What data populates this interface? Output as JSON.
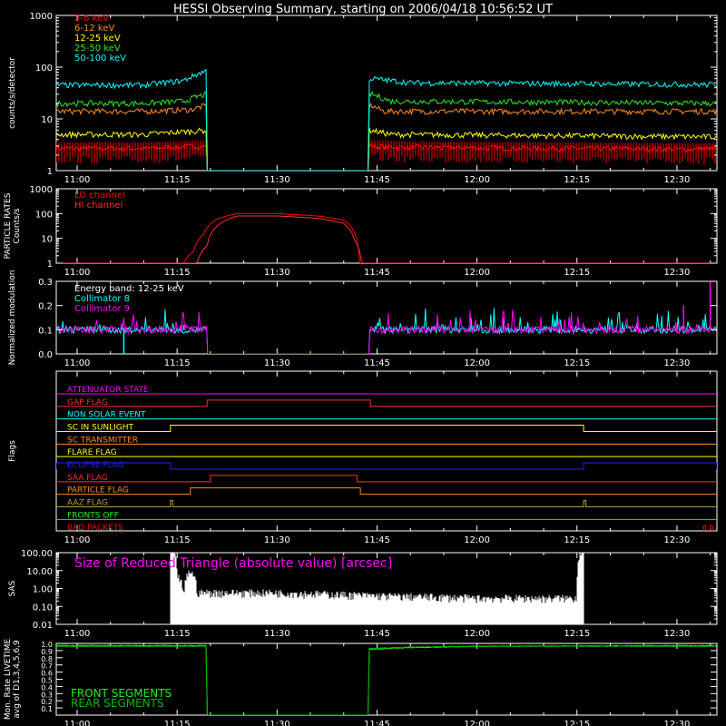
{
  "title": "HESSI Observing Summary, starting on 2006/04/18 10:56:52 UT",
  "colors": {
    "background": "#000000",
    "axis": "#ffffff",
    "red": "#ff0000",
    "orange": "#ff8c1a",
    "yellow": "#ffff00",
    "green": "#22ee22",
    "cyan": "#00ffff",
    "magenta": "#ff00ff",
    "blue": "#2222ff",
    "olive": "#b8a030",
    "darkgreen": "#00bb00",
    "crimson": "#ff3030",
    "gray": "#999999"
  },
  "time_axis": {
    "start": "10:56:52",
    "end": "12:36:00",
    "tick_labels": [
      "11:00",
      "11:15",
      "11:30",
      "11:45",
      "12:00",
      "12:15",
      "12:30"
    ],
    "minor_tick_minutes": 5
  },
  "chart_data": [
    {
      "type": "line",
      "panel": "count_rates",
      "ylabel": "counts/s/detector",
      "yscale": "log",
      "ylim": [
        1,
        1000
      ],
      "tick_labels": [
        "1",
        "10",
        "100",
        "1000"
      ],
      "gaps": [
        [
          "11:19:30",
          "11:43:50"
        ]
      ],
      "series": [
        {
          "name": "3-6 keV",
          "color": "#ff0000",
          "points": [
            [
              "10:56:52",
              2.7
            ],
            [
              "11:10:00",
              2.7
            ],
            [
              "11:19:20",
              3.0
            ],
            [
              "11:44:10",
              3.0
            ],
            [
              "11:50:00",
              2.8
            ],
            [
              "12:30:00",
              2.6
            ],
            [
              "12:36:00",
              2.6
            ]
          ]
        },
        {
          "name": "6-12 keV",
          "color": "#ff8c1a",
          "points": [
            [
              "10:56:52",
              14
            ],
            [
              "11:10:00",
              14
            ],
            [
              "11:17:00",
              15
            ],
            [
              "11:19:20",
              18
            ],
            [
              "11:44:10",
              18
            ],
            [
              "11:46:00",
              14
            ],
            [
              "12:36:00",
              14
            ]
          ]
        },
        {
          "name": "12-25 keV",
          "color": "#ffff00",
          "points": [
            [
              "10:56:52",
              5
            ],
            [
              "11:10:00",
              5
            ],
            [
              "11:19:20",
              6
            ],
            [
              "11:44:10",
              6
            ],
            [
              "11:47:00",
              5
            ],
            [
              "12:36:00",
              4.5
            ]
          ]
        },
        {
          "name": "25-50 keV",
          "color": "#22ee22",
          "points": [
            [
              "10:56:52",
              20
            ],
            [
              "11:10:00",
              20
            ],
            [
              "11:16:00",
              22
            ],
            [
              "11:19:20",
              30
            ],
            [
              "11:44:10",
              30
            ],
            [
              "11:47:00",
              22
            ],
            [
              "12:36:00",
              20
            ]
          ]
        },
        {
          "name": "50-100 keV",
          "color": "#00ffff",
          "points": [
            [
              "10:56:52",
              45
            ],
            [
              "11:10:00",
              45
            ],
            [
              "11:16:00",
              55
            ],
            [
              "11:19:20",
              85
            ],
            [
              "11:44:10",
              60
            ],
            [
              "11:50:00",
              50
            ],
            [
              "12:36:00",
              46
            ]
          ]
        }
      ]
    },
    {
      "type": "line",
      "panel": "particle_rates",
      "ylabel": "PARTICLE RATES Counts/s",
      "yscale": "log",
      "ylim": [
        1,
        1000
      ],
      "tick_labels": [
        "1",
        "10",
        "100",
        "1000"
      ],
      "series": [
        {
          "name": "LO channel",
          "color": "#ff0000",
          "points": [
            [
              "10:56:52",
              1
            ],
            [
              "11:16:00",
              1
            ],
            [
              "11:17:30",
              3
            ],
            [
              "11:19:00",
              15
            ],
            [
              "11:21:00",
              60
            ],
            [
              "11:24:00",
              100
            ],
            [
              "11:30:00",
              100
            ],
            [
              "11:36:00",
              80
            ],
            [
              "11:40:00",
              55
            ],
            [
              "11:41:30",
              20
            ],
            [
              "11:42:20",
              1
            ],
            [
              "12:36:00",
              1
            ]
          ]
        },
        {
          "name": "HI channel",
          "color": "#ff3030",
          "points": [
            [
              "10:56:52",
              1
            ],
            [
              "11:18:00",
              1
            ],
            [
              "11:19:30",
              5
            ],
            [
              "11:21:30",
              40
            ],
            [
              "11:24:00",
              80
            ],
            [
              "11:30:00",
              80
            ],
            [
              "11:36:00",
              65
            ],
            [
              "11:40:00",
              40
            ],
            [
              "11:41:40",
              8
            ],
            [
              "11:42:40",
              1
            ],
            [
              "12:36:00",
              1
            ]
          ]
        }
      ]
    },
    {
      "type": "line",
      "panel": "modulation",
      "ylabel": "Normalized modulation",
      "ylim": [
        0,
        0.3
      ],
      "tick_labels": [
        "0.0",
        "0.1",
        "0.2",
        "0.3"
      ],
      "annotation": "Energy band: 12-25 keV",
      "gaps": [
        [
          "11:19:30",
          "11:43:50"
        ]
      ],
      "series": [
        {
          "name": "Collimator 8",
          "color": "#00ffff",
          "base": 0.1,
          "outliers": [
            [
              "11:07:00",
              0.0
            ],
            [
              "11:16:00",
              0.12
            ]
          ]
        },
        {
          "name": "Collimator 9",
          "color": "#ff00ff",
          "base": 0.1,
          "outliers": [
            [
              "12:35:00",
              0.3
            ],
            [
              "12:31:00",
              0.2
            ]
          ]
        }
      ]
    },
    {
      "type": "line",
      "panel": "flags",
      "ylabel": "Flags",
      "series": [
        {
          "name": "ATTENUATOR STATE",
          "color": "#ff00ff",
          "steps": []
        },
        {
          "name": "GAP FLAG",
          "color": "#ff3030",
          "steps": [
            [
              "11:19:30",
              "11:44:00"
            ]
          ]
        },
        {
          "name": "NON SOLAR EVENT",
          "color": "#00ffff",
          "steps": []
        },
        {
          "name": "SC IN SUNLIGHT",
          "color": "#ffff00",
          "steps": [
            [
              "11:14:00",
              "12:16:00"
            ]
          ]
        },
        {
          "name": "SC TRANSMITTER",
          "color": "#ff8c1a",
          "steps": []
        },
        {
          "name": "FLARE FLAG",
          "color": "#ffff00",
          "steps": []
        },
        {
          "name": "ECLIPSE FLAG",
          "color": "#2222ff",
          "steps": [
            [
              "10:56:52",
              "11:14:00"
            ],
            [
              "12:16:00",
              "12:36:00"
            ]
          ]
        },
        {
          "name": "SAA FLAG",
          "color": "#ff3030",
          "steps": [
            [
              "11:20:00",
              "11:42:00"
            ]
          ]
        },
        {
          "name": "PARTICLE FLAG",
          "color": "#ff8c1a",
          "steps": [
            [
              "11:17:00",
              "11:42:30"
            ]
          ]
        },
        {
          "name": "AAZ FLAG",
          "color": "#b8a030",
          "steps": [
            [
              "11:14:00",
              "11:14:20"
            ],
            [
              "12:16:00",
              "12:16:20"
            ]
          ]
        },
        {
          "name": "FRONTS OFF",
          "color": "#22ee22",
          "steps": []
        },
        {
          "name": "BAD PACKETS",
          "color": "#ff0000",
          "steps": [
            [
              "12:34:00",
              "12:34:20"
            ],
            [
              "12:35:00",
              "12:35:20"
            ]
          ]
        }
      ]
    },
    {
      "type": "line",
      "panel": "sas",
      "ylabel": "SAS",
      "yscale": "log",
      "ylim": [
        0.01,
        100
      ],
      "tick_labels": [
        "0.01",
        "0.10",
        "1.00",
        "10.00",
        "100.00"
      ],
      "annotation": "Size of Reduced Triangle (absolute value) [arcsec]",
      "series": [
        {
          "name": "Size of Reduced Triangle",
          "color": "#ffffff",
          "range": [
            [
              "11:14:00",
              "12:16:00"
            ]
          ],
          "points": [
            [
              "11:14:00",
              100
            ],
            [
              "11:15:00",
              3
            ],
            [
              "11:16:00",
              0.05
            ],
            [
              "11:17:00",
              5
            ],
            [
              "11:18:00",
              0.3
            ],
            [
              "11:30:00",
              0.3
            ],
            [
              "11:45:00",
              0.2
            ],
            [
              "12:00:00",
              0.15
            ],
            [
              "12:15:00",
              0.15
            ],
            [
              "12:16:00",
              100
            ]
          ]
        }
      ]
    },
    {
      "type": "line",
      "panel": "livetime",
      "ylabel": "Mon. Rate LIVETIME avg of D1,3,4,5,6,9",
      "ylim": [
        0,
        1.0
      ],
      "tick_labels": [
        "0.1",
        "0.2",
        "0.3",
        "0.4",
        "0.5",
        "0.6",
        "0.7",
        "0.8",
        "0.9",
        "1.0"
      ],
      "gaps": [
        [
          "11:19:30",
          "11:43:50"
        ]
      ],
      "series": [
        {
          "name": "FRONT SEGMENTS",
          "color": "#22ee22",
          "points": [
            [
              "10:56:52",
              0.97
            ],
            [
              "11:19:20",
              0.97
            ],
            [
              "11:44:10",
              0.92
            ],
            [
              "11:50:00",
              0.94
            ],
            [
              "12:00:00",
              0.96
            ],
            [
              "12:36:00",
              0.97
            ]
          ]
        },
        {
          "name": "REAR SEGMENTS",
          "color": "#00bb00",
          "points": [
            [
              "10:56:52",
              0.96
            ],
            [
              "11:19:20",
              0.96
            ],
            [
              "11:44:10",
              0.93
            ],
            [
              "11:50:00",
              0.95
            ],
            [
              "12:00:00",
              0.96
            ],
            [
              "12:36:00",
              0.96
            ]
          ]
        }
      ]
    }
  ]
}
